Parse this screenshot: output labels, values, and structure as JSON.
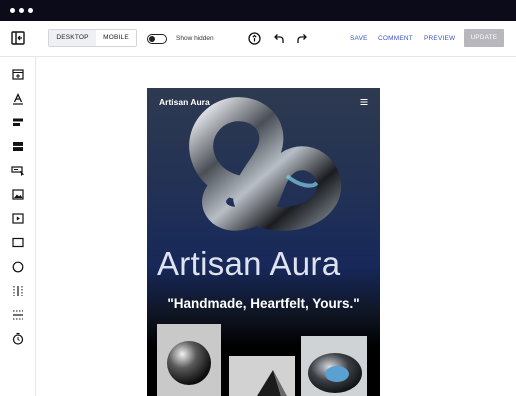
{
  "toolbar": {
    "view_modes": [
      {
        "label": "DESKTOP",
        "active": true
      },
      {
        "label": "MOBILE",
        "active": false
      }
    ],
    "show_hidden_label": "Show hidden",
    "show_hidden_on": false,
    "actions": {
      "save": "SAVE",
      "comment": "COMMENT",
      "preview": "PREVIEW",
      "update": "UPDATE"
    },
    "accent_color": "#3b55c9"
  },
  "sidebar": {
    "back_icon": "collapse-panel-icon",
    "tools": [
      "section-icon",
      "text-icon",
      "paragraph-icon",
      "container-icon",
      "input-icon",
      "image-icon",
      "video-icon",
      "rectangle-icon",
      "circle-icon",
      "columns-icon",
      "divider-icon",
      "timer-icon"
    ]
  },
  "preview": {
    "brand": "Artisan Aura",
    "menu_icon": "hamburger-menu-icon",
    "hero_title": "Artisan Aura",
    "tagline": "\"Handmade, Heartfelt, Yours.\""
  }
}
